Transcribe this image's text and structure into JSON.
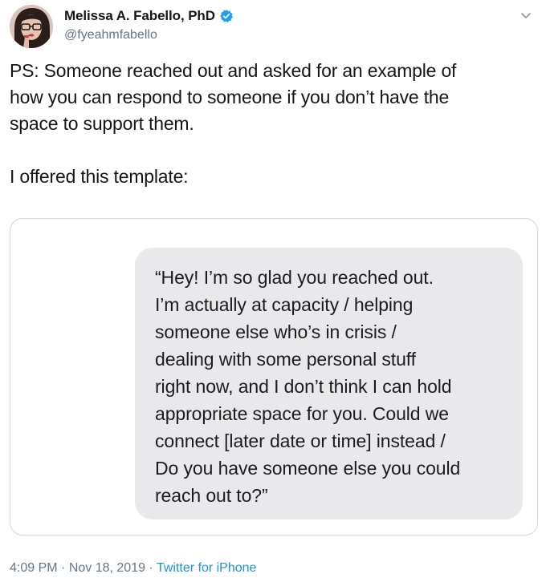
{
  "author": {
    "display_name": "Melissa A. Fabello, PhD",
    "handle": "@fyeahmfabello",
    "verified": true,
    "avatar_icon": "avatar-photo",
    "verified_icon": "verified-badge-icon",
    "verified_color": "#1da1f2"
  },
  "menu": {
    "caret_icon": "chevron-down-icon"
  },
  "tweet": {
    "paragraph_1": "PS: Someone reached out and asked for an example of\nhow you can respond to someone if you don’t have the\nspace to support them.",
    "paragraph_2": "I offered this template:"
  },
  "attachment": {
    "message": "“Hey! I’m so glad you reached out.\nI’m actually at capacity / helping\nsomeone else who’s in crisis /\ndealing with some personal stuff\nright now, and I don’t think I can hold\nappropriate space for you. Could we\nconnect [later date or time] instead /\nDo you have someone else you could\nreach out to?”"
  },
  "footer": {
    "time": "4:09 PM",
    "separator_1": " · ",
    "date": "Nov 18, 2019",
    "separator_2": " · ",
    "source": "Twitter for iPhone"
  },
  "colors": {
    "text": "#14171a",
    "secondary_text": "#657786",
    "link": "#1b95e0",
    "bubble": "#e9e9eb",
    "card_border": "#cfd9de"
  }
}
